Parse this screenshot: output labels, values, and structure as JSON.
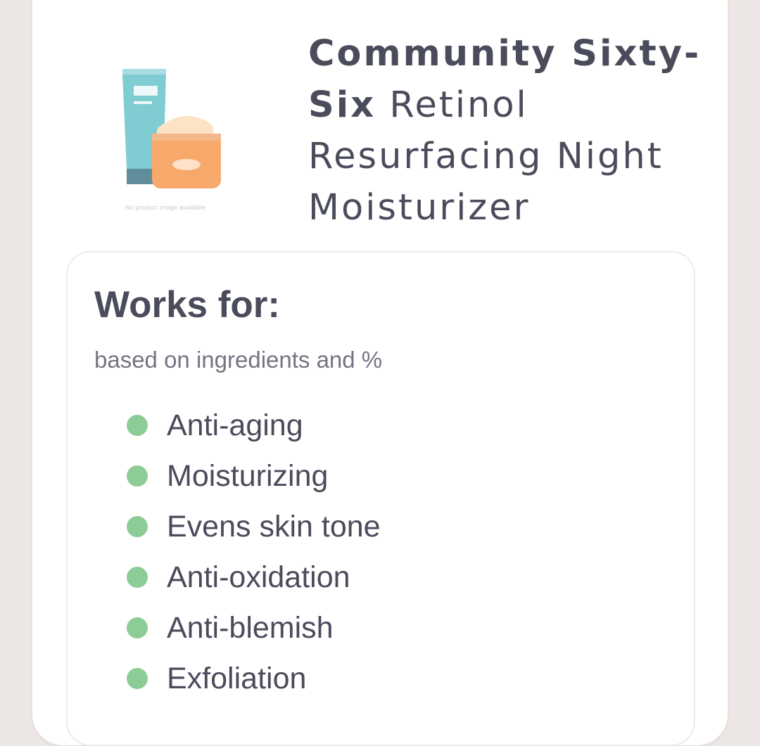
{
  "product": {
    "brand": "Community Sixty-Six",
    "name": "Retinol Resurfacing Night Moisturizer",
    "image_placeholder_caption": "No product image available",
    "image_icon": "tube-and-jar-illustration"
  },
  "works_for": {
    "heading": "Works for:",
    "subtitle": "based on ingredients and %",
    "bullet_color": "#8ccc96",
    "items": [
      {
        "label": "Anti-aging"
      },
      {
        "label": "Moisturizing"
      },
      {
        "label": "Evens skin tone"
      },
      {
        "label": "Anti-oxidation"
      },
      {
        "label": "Anti-blemish"
      },
      {
        "label": "Exfoliation"
      }
    ]
  }
}
